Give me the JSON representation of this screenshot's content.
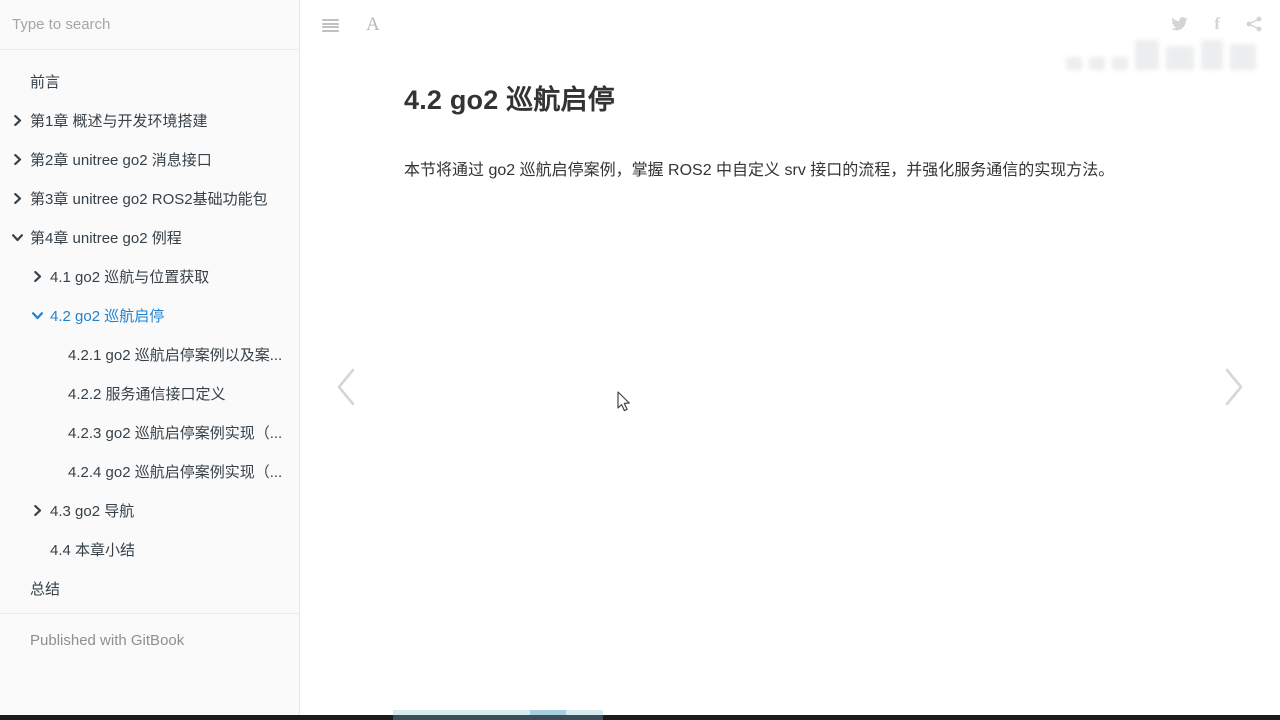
{
  "sidebar": {
    "search": {
      "placeholder": "Type to search"
    },
    "items": [
      {
        "label": "前言",
        "level": 1,
        "chevron": "none",
        "active": false
      },
      {
        "label": "第1章 概述与开发环境搭建",
        "level": 1,
        "chevron": "right",
        "active": false
      },
      {
        "label": "第2章 unitree go2 消息接口",
        "level": 1,
        "chevron": "right",
        "active": false
      },
      {
        "label": "第3章 unitree go2 ROS2基础功能包",
        "level": 1,
        "chevron": "right",
        "active": false
      },
      {
        "label": "第4章 unitree go2 例程",
        "level": 1,
        "chevron": "down",
        "active": false
      },
      {
        "label": "4.1 go2 巡航与位置获取",
        "level": 2,
        "chevron": "right",
        "active": false
      },
      {
        "label": "4.2 go2 巡航启停",
        "level": 2,
        "chevron": "down",
        "active": true
      },
      {
        "label": "4.2.1 go2 巡航启停案例以及案...",
        "level": 3,
        "chevron": "none",
        "active": false
      },
      {
        "label": "4.2.2 服务通信接口定义",
        "level": 3,
        "chevron": "none",
        "active": false
      },
      {
        "label": "4.2.3 go2 巡航启停案例实现（...",
        "level": 3,
        "chevron": "none",
        "active": false
      },
      {
        "label": "4.2.4 go2 巡航启停案例实现（...",
        "level": 3,
        "chevron": "none",
        "active": false
      },
      {
        "label": "4.3 go2 导航",
        "level": 2,
        "chevron": "right",
        "active": false
      },
      {
        "label": "4.4 本章小结",
        "level": 2,
        "chevron": "none",
        "active": false
      },
      {
        "label": "总结",
        "level": 1,
        "chevron": "none",
        "active": false
      }
    ],
    "footer_text": "Published with GitBook"
  },
  "toolbar": {
    "menu_icon": "hamburger-icon",
    "font_button_label": "A"
  },
  "share": {
    "icons": [
      "twitter-icon",
      "facebook-icon",
      "share-icon"
    ]
  },
  "content": {
    "title": "4.2 go2 巡航启停",
    "paragraph": "本节将通过 go2 巡航启停案例，掌握 ROS2 中自定义 srv 接口的流程，并强化服务通信的实现方法。"
  },
  "colors": {
    "active_link": "#1e82d2",
    "sidebar_text": "#364149",
    "body_text": "#333333",
    "sidebar_bg": "#fafafa"
  }
}
